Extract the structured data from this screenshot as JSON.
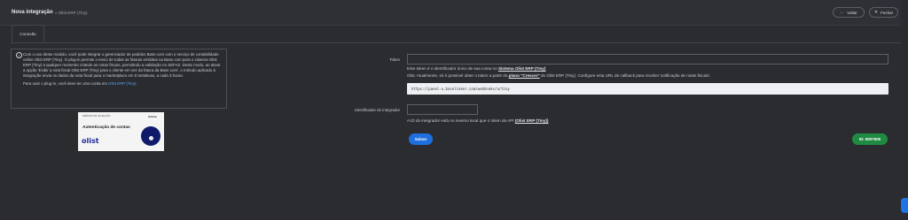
{
  "header": {
    "title": "Nova integração",
    "subtitle": "» Olist ERP (Tiny)",
    "back_icon": "arrow-left-icon",
    "back_label": "Voltar",
    "close_icon": "close-icon",
    "close_label": "Fechar"
  },
  "tabs": [
    {
      "label": "Conexão"
    }
  ],
  "info": {
    "icon": "info-icon",
    "paragraph": "Com o uso deste módulo, você pode integrar o gerenciador de pedidos Base.com com o serviço de contabilidade online Olist ERP (Tiny). O plug-in permite o envio de todas as faturas emitidas na Base.com para o sistema Olist ERP (Tiny) a qualquer momento criando as notas fiscais, permitindo a validação no SEFAZ. Deste modo, ao ativar a opção 'Exibir a nota fiscal Olist ERP (Tiny) para o cliente em vez da fatura da Base.com', o método aplicado à integração envia os dados da nota fiscal para o marketplace em 5 tentativas, a cada 3 horas.",
    "plugin_prefix": "Para usar o plug-in, você deve ter uma conta em",
    "plugin_link": "Olist ERP (Tiny)",
    "plugin_suffix": "."
  },
  "promo": {
    "top_text": "PERÍODO DE VALIDAÇÃO",
    "brand": "Sebrae",
    "title": "Autenticação de contas",
    "logo": "olist"
  },
  "form": {
    "token_label": "Token",
    "token_value": "",
    "token_help_prefix": "Este token é o identificador único de sua conta no",
    "token_help_link": "Sistema Olist ERP (Tiny)",
    "obs_prefix": "Obs: Atualmente, só é possível obter o token a partir do",
    "obs_link": "plano \"Crescer\"",
    "obs_suffix": "do Olist ERP (Tiny). Configure esta URL de callback para receber notificação de notas fiscais:",
    "callback_url": "https://panel-u.baselinker.com/webhooks/a/tiny",
    "integrator_label": "Identificador do integrador",
    "integrator_value": "",
    "integrator_help_prefix": "A ID do integrador está no mesmo local que o token da API",
    "integrator_help_link": "(Olist ERP (Tiny))",
    "save_label": "Salvar",
    "id_badge": "ID: 8007605"
  },
  "colors": {
    "background": "#2b2c30",
    "accent": "#1e6fe0",
    "success": "#1f8a42",
    "link": "#5ba6f5"
  }
}
